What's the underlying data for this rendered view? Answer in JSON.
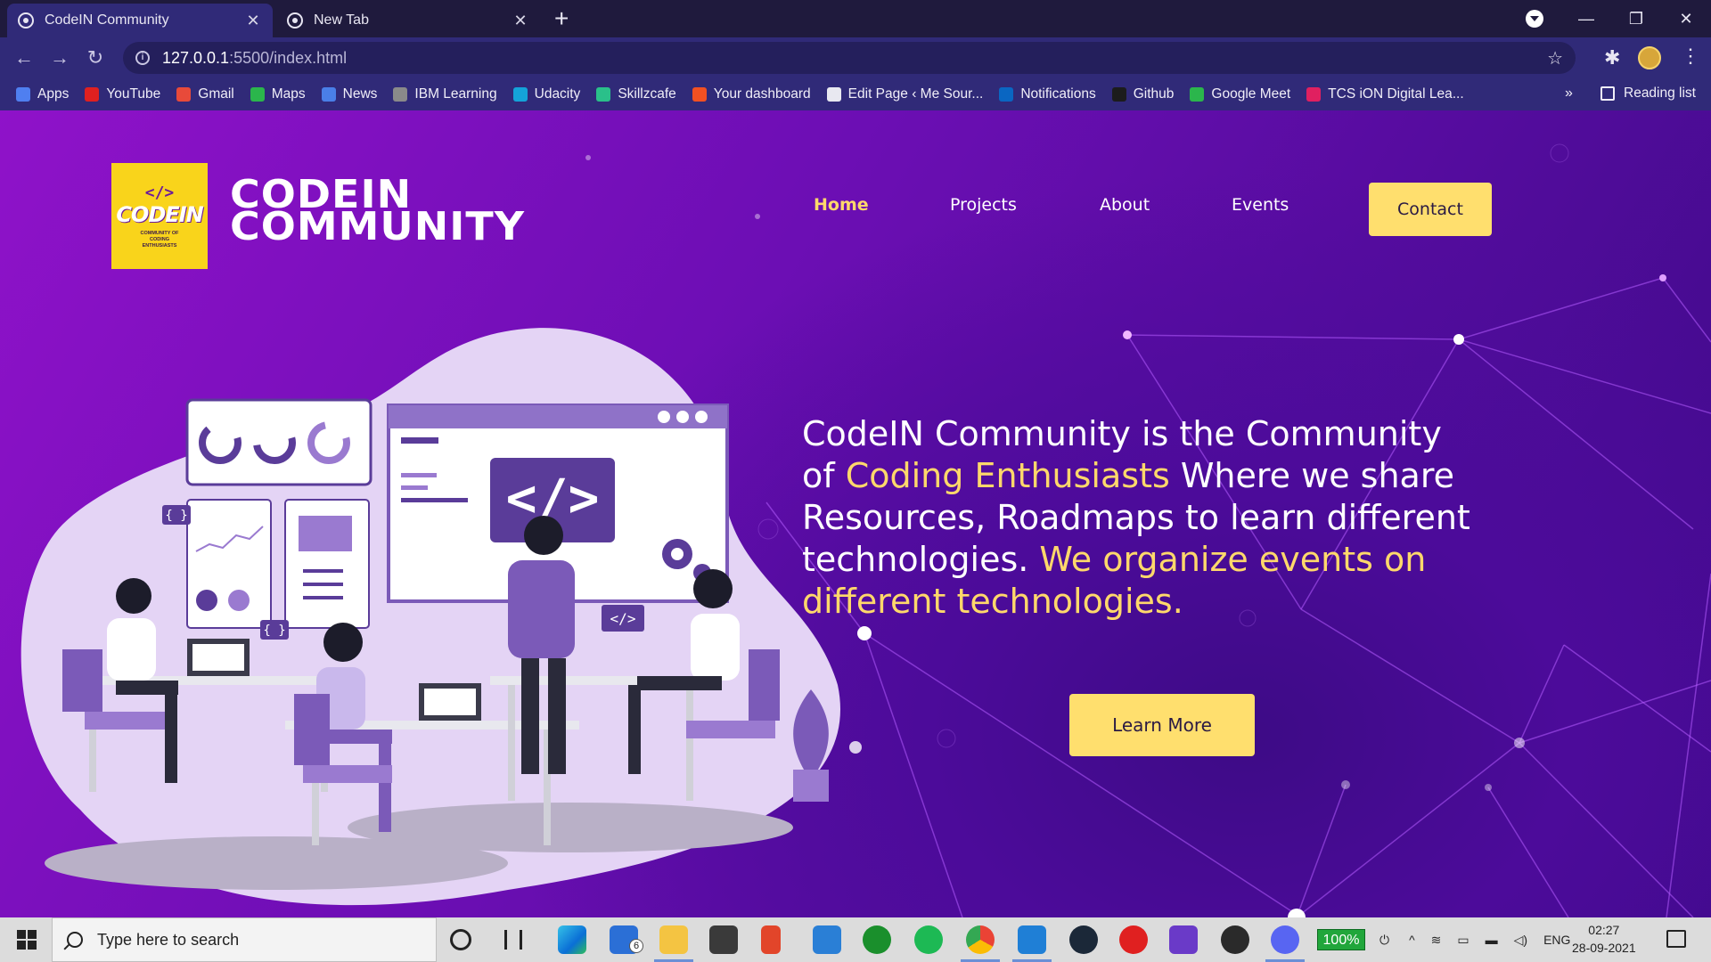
{
  "browser": {
    "tabs": [
      {
        "title": "CodeIN Community",
        "active": true
      },
      {
        "title": "New Tab",
        "active": false
      }
    ],
    "address": {
      "host": "127.0.0.1",
      "path": ":5500/index.html"
    },
    "bookmarks": [
      {
        "label": "Apps",
        "icon": "apps-grid-icon",
        "color": "#4f7ff0"
      },
      {
        "label": "YouTube",
        "icon": "youtube-icon",
        "color": "#e02020"
      },
      {
        "label": "Gmail",
        "icon": "gmail-icon",
        "color": "#e84a3a"
      },
      {
        "label": "Maps",
        "icon": "maps-icon",
        "color": "#2bb64c"
      },
      {
        "label": "News",
        "icon": "news-icon",
        "color": "#4a7fe8"
      },
      {
        "label": "IBM Learning",
        "icon": "ibm-icon",
        "color": "#8a8a8a"
      },
      {
        "label": "Udacity",
        "icon": "udacity-icon",
        "color": "#14a3d9"
      },
      {
        "label": "Skillzcafe",
        "icon": "skillzcafe-icon",
        "color": "#2ac08a"
      },
      {
        "label": "Your dashboard",
        "icon": "microsoft-icon",
        "color": "#f25022"
      },
      {
        "label": "Edit Page ‹ Me Sour...",
        "icon": "wordpress-icon",
        "color": "#e8e8f0"
      },
      {
        "label": "Notifications",
        "icon": "linkedin-icon",
        "color": "#0a66c2"
      },
      {
        "label": "Github",
        "icon": "github-icon",
        "color": "#1c1c1c"
      },
      {
        "label": "Google Meet",
        "icon": "google-meet-icon",
        "color": "#2bb64c"
      },
      {
        "label": "TCS iON Digital Lea...",
        "icon": "tcs-ion-icon",
        "color": "#e02060"
      }
    ],
    "bookmarks_more": "»",
    "reading_list": "Reading list"
  },
  "site": {
    "logo": {
      "symbol": "</>",
      "word": "CODEIN",
      "tagline": "COMMUNITY OF CODING ENTHUSIASTS"
    },
    "brand_line1": "CODEIN",
    "brand_line2": "COMMUNITY",
    "nav": [
      {
        "label": "Home",
        "active": true
      },
      {
        "label": "Projects",
        "active": false
      },
      {
        "label": "About",
        "active": false
      },
      {
        "label": "Events",
        "active": false
      }
    ],
    "contact_label": "Contact",
    "hero": {
      "part1": "CodeIN Community is the Community of ",
      "part2": "Coding Enthusiasts",
      "part3": " Where we share Resources, Roadmaps to learn different technologies. ",
      "part4": "We organize events on different technologies."
    },
    "learn_more_label": "Learn More",
    "colors": {
      "accent": "#ffd86b",
      "button": "#ffdf6e",
      "logo_bg": "#f9d41b",
      "bg_start": "#8f12c9",
      "bg_end": "#3a0a85"
    }
  },
  "taskbar": {
    "search_placeholder": "Type here to search",
    "mail_badge": "6",
    "battery": "100%",
    "language": "ENG",
    "time": "02:27",
    "date": "28-09-2021"
  }
}
